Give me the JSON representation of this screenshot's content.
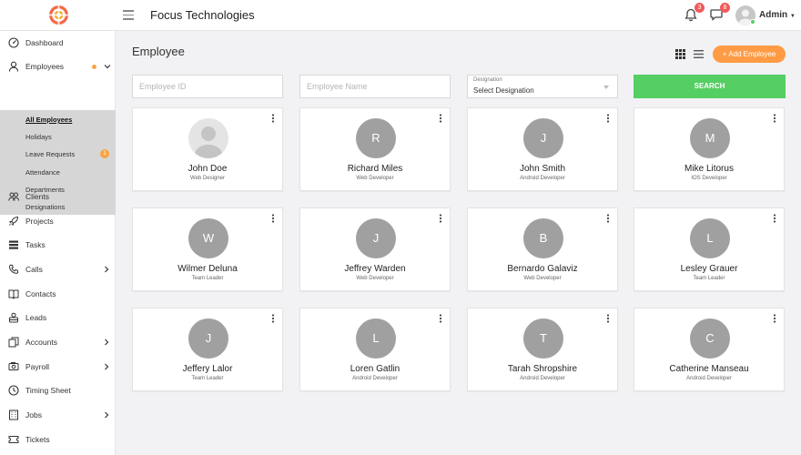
{
  "header": {
    "brand": "Focus Technologies",
    "notifications_count": "3",
    "messages_count": "8",
    "user_name": "Admin"
  },
  "sidebar": {
    "items": [
      {
        "label": "Dashboard",
        "icon": "dashboard-icon"
      },
      {
        "label": "Employees",
        "icon": "user-icon"
      },
      {
        "label": "Clients",
        "icon": "users-icon"
      },
      {
        "label": "Projects",
        "icon": "rocket-icon"
      },
      {
        "label": "Tasks",
        "icon": "tasks-icon"
      },
      {
        "label": "Calls",
        "icon": "phone-icon"
      },
      {
        "label": "Contacts",
        "icon": "book-icon"
      },
      {
        "label": "Leads",
        "icon": "leads-icon"
      },
      {
        "label": "Accounts",
        "icon": "copy-icon"
      },
      {
        "label": "Payroll",
        "icon": "money-icon"
      },
      {
        "label": "Timing Sheet",
        "icon": "clock-icon"
      },
      {
        "label": "Jobs",
        "icon": "building-icon"
      },
      {
        "label": "Tickets",
        "icon": "ticket-icon"
      }
    ],
    "employees_submenu": [
      {
        "label": "All Employees",
        "active": true
      },
      {
        "label": "Holidays"
      },
      {
        "label": "Leave Requests",
        "badge": "1"
      },
      {
        "label": "Attendance"
      },
      {
        "label": "Departments"
      },
      {
        "label": "Designations"
      }
    ]
  },
  "page": {
    "title": "Employee",
    "add_button": "+ Add Employee"
  },
  "filters": {
    "employee_id_placeholder": "Employee ID",
    "employee_name_placeholder": "Employee Name",
    "designation_label": "Designation",
    "designation_value": "Select Designation",
    "search_button": "SEARCH"
  },
  "employees": [
    {
      "name": "John Doe",
      "role": "Web Designer",
      "initial": ""
    },
    {
      "name": "Richard Miles",
      "role": "Web Developer",
      "initial": "R"
    },
    {
      "name": "John Smith",
      "role": "Android Developer",
      "initial": "J"
    },
    {
      "name": "Mike Litorus",
      "role": "IOS Developer",
      "initial": "M"
    },
    {
      "name": "Wilmer Deluna",
      "role": "Team Leader",
      "initial": "W"
    },
    {
      "name": "Jeffrey Warden",
      "role": "Web Developer",
      "initial": "J"
    },
    {
      "name": "Bernardo Galaviz",
      "role": "Web Developer",
      "initial": "B"
    },
    {
      "name": "Lesley Grauer",
      "role": "Team Leader",
      "initial": "L"
    },
    {
      "name": "Jeffery Lalor",
      "role": "Team Leader",
      "initial": "J"
    },
    {
      "name": "Loren Gatlin",
      "role": "Android Developer",
      "initial": "L"
    },
    {
      "name": "Tarah Shropshire",
      "role": "Android Developer",
      "initial": "T"
    },
    {
      "name": "Catherine Manseau",
      "role": "Android Developer",
      "initial": "C"
    }
  ],
  "colors": {
    "accent_orange": "#ff9b44",
    "search_green": "#55ce63",
    "badge_red": "#f05a5a",
    "avatar_gray": "#a0a0a0"
  }
}
